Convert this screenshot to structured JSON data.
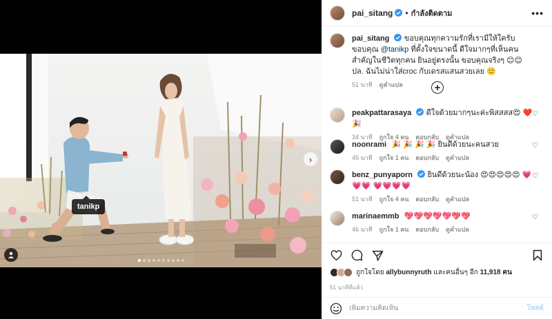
{
  "post": {
    "author": "pai_sitang",
    "follow_status": "กำลังติดตาม",
    "more_icon": "more-horizontal-icon"
  },
  "media": {
    "tag_label": "tanikp",
    "total_slides": 10,
    "active_slide": 1
  },
  "caption": {
    "author": "pai_sitang",
    "text_part1": "ขอบคุณทุกความรักที่เรามีให้ใครับ ขอบคุณ ",
    "mention": "@tanikp",
    "text_part2": " ที่ตั้งใจขนาดนี้ ดีใจมากๆที่เห็นคนสำคัญในชีวิตทุกคน ยินอยู่ตรงนั้น ขอบคุณจริงๆ 😊😊 ปล. ฉันไม่น่าใส่croc กับเดรสแสนสวยเลย 🙂",
    "time": "51 นาที",
    "translate": "ดูคำแปล"
  },
  "comments": [
    {
      "user": "peakpattarasaya",
      "text": "ดีใจด้วยมากๆนะค่ะพิสสสส😍 ❤️ 🎉",
      "time": "34 นาที",
      "likes": "ถูกใจ 4 คน",
      "reply": "ตอบกลับ",
      "translate": "ดูคำแปล"
    },
    {
      "user": "noonrami",
      "text": "🎉 🎉 🎉 🎉 ยินดีด้วยนะคนสวย",
      "time": "45 นาที",
      "likes": "ถูกใจ 1 คน",
      "reply": "ตอบกลับ",
      "translate": "ดูคำแปล"
    },
    {
      "user": "benz_punyaporn",
      "text": "ยินดีด้วยนะน้อง 😍😍😍😍😍 💗💗💗 💗💗💗💗",
      "time": "51 นาที",
      "likes": "ถูกใจ 4 คน",
      "reply": "ตอบกลับ",
      "translate": "ดูคำแปล"
    },
    {
      "user": "marinaemmb",
      "text": "💖💖💖💖💖💖💖",
      "time": "46 นาที",
      "likes": "ถูกใจ 1 คน",
      "reply": "ตอบกลับ",
      "translate": "ดูคำแปล"
    }
  ],
  "likes_summary": {
    "prefix": "ถูกใจโดย",
    "user": "allybunnyruth",
    "middle": "และคนอื่นๆ อีก",
    "count": "11,918",
    "suffix": "คน"
  },
  "posted_time": "51 นาทีที่แล้ว",
  "composer": {
    "placeholder": "เพิ่มความคิดเห็น",
    "post_label": "โพสต์"
  },
  "colors": {
    "verified": "#3897f0",
    "link": "#00376b",
    "muted": "#8e8e8e"
  }
}
